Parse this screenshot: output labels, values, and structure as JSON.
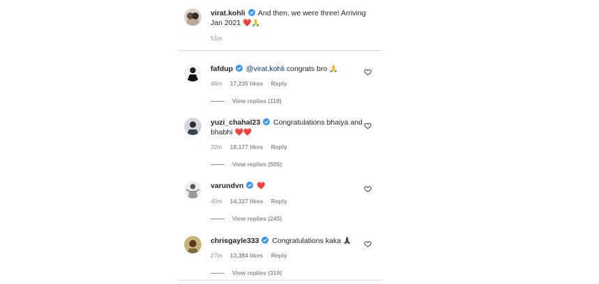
{
  "post": {
    "username": "virat.kohli",
    "text": "And then, we were three! Arriving Jan 2021",
    "emojis": "❤️🙏",
    "time": "51m"
  },
  "comments": [
    {
      "username": "fafdup",
      "mention": "@virat.kohli",
      "text": "congrats bro",
      "emojis": "🙏",
      "time": "48m",
      "likes": "17,235 likes",
      "reply": "Reply",
      "view_replies": "View replies (118)"
    },
    {
      "username": "yuzi_chahal23",
      "mention": "",
      "text": "Congratulations bhaiya and bhabhi",
      "emojis": "❤️❤️",
      "time": "32m",
      "likes": "18,177 likes",
      "reply": "Reply",
      "view_replies": "View replies (505)"
    },
    {
      "username": "varundvn",
      "mention": "",
      "text": "",
      "emojis": "❤️",
      "time": "40m",
      "likes": "14,327 likes",
      "reply": "Reply",
      "view_replies": "View replies (245)"
    },
    {
      "username": "chrisgayle333",
      "mention": "",
      "text": "Congratulations kaka",
      "emojis": "🙏🏿",
      "time": "27m",
      "likes": "13,384 likes",
      "reply": "Reply",
      "view_replies": "View replies (319)"
    }
  ],
  "colors": {
    "verified": "#3897f0",
    "heart": "#e0245e",
    "meta": "#8e8e8e"
  }
}
